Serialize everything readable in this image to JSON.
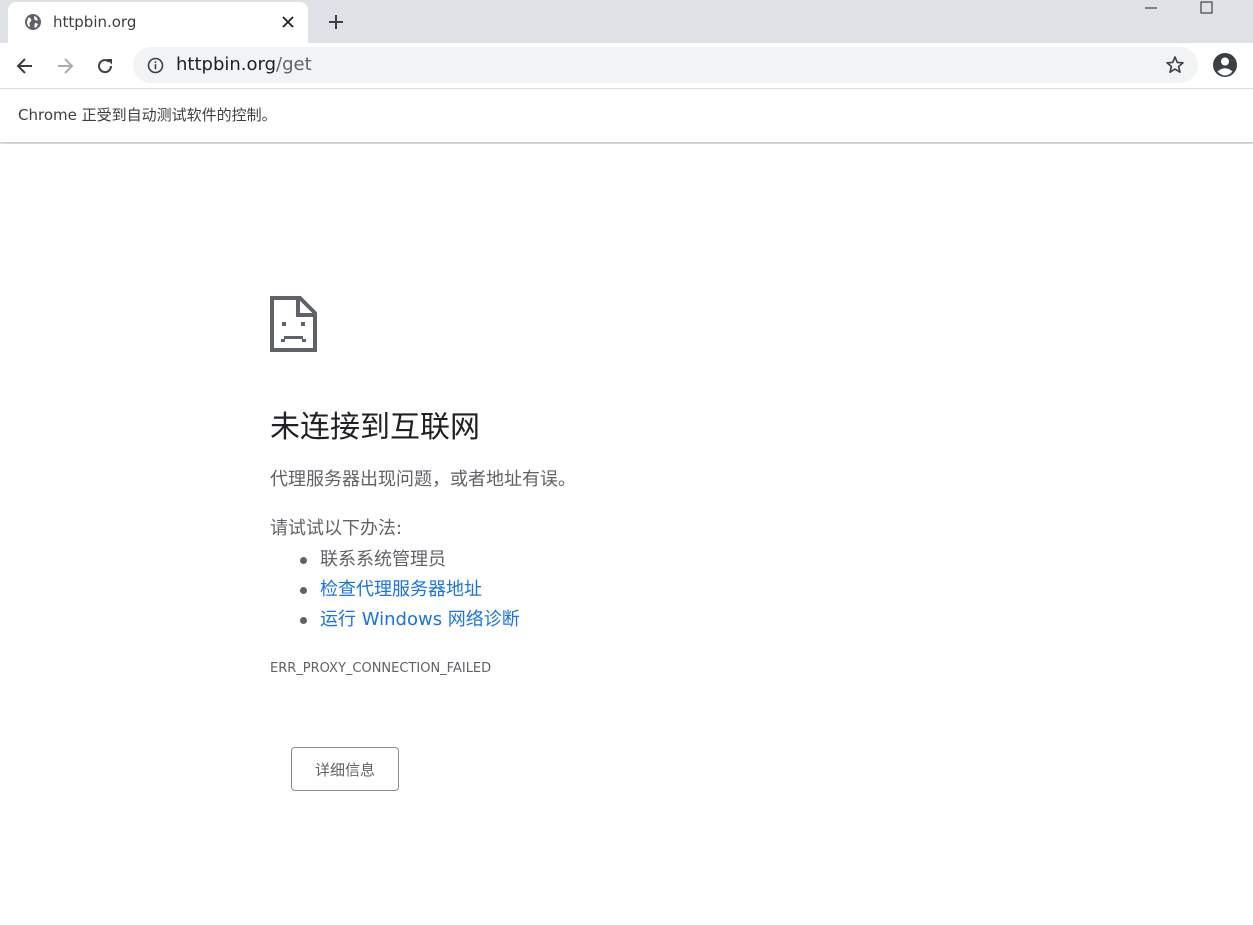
{
  "tab": {
    "title": "httpbin.org",
    "favicon": "globe-icon",
    "close_icon": "close-icon"
  },
  "new_tab_icon": "plus-icon",
  "window_controls": [
    "minimize-icon",
    "maximize-icon"
  ],
  "toolbar": {
    "back_icon": "arrow-left-icon",
    "forward_icon": "arrow-right-icon",
    "reload_icon": "reload-icon",
    "site_info_icon": "info-icon",
    "url_host": "httpbin.org",
    "url_path": "/get",
    "bookmark_icon": "star-icon",
    "profile_icon": "account-circle-icon"
  },
  "infobar": {
    "text": "Chrome 正受到自动测试软件的控制。"
  },
  "error_page": {
    "icon": "sad-document-icon",
    "heading": "未连接到互联网",
    "description": "代理服务器出现问题，或者地址有误。",
    "suggestions_title": "请试试以下办法:",
    "suggestions": [
      {
        "label": "联系系统管理员",
        "link": false
      },
      {
        "label": "检查代理服务器地址",
        "link": true
      },
      {
        "label": "运行 Windows 网络诊断",
        "link": true
      }
    ],
    "error_code": "ERR_PROXY_CONNECTION_FAILED",
    "details_button": "详细信息"
  },
  "colors": {
    "tabstrip_bg": "#dee1e6",
    "omnibox_bg": "#f1f3f4",
    "link": "#1a73e8",
    "text_secondary": "#5f6368",
    "text_primary": "#202124"
  }
}
